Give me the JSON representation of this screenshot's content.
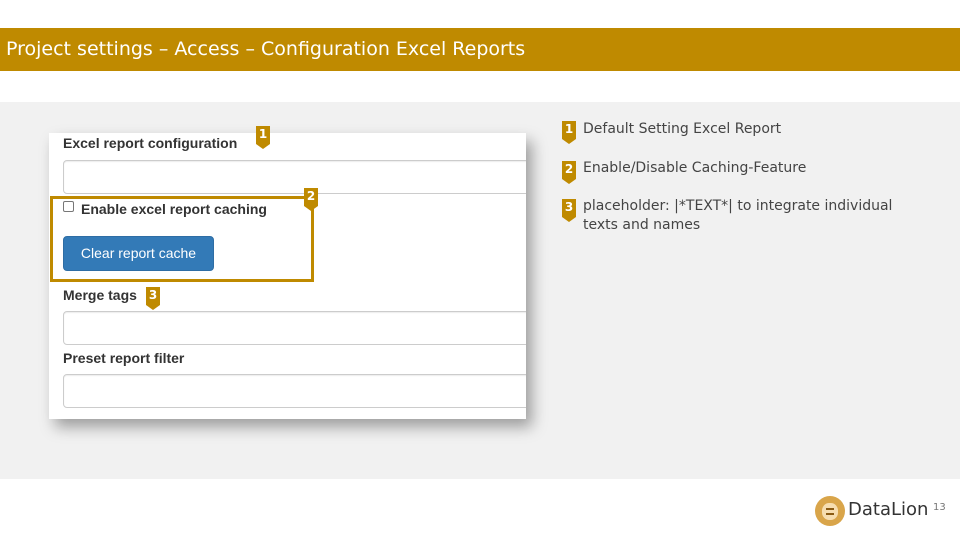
{
  "header": {
    "title": "Project settings – Access – Configuration Excel Reports"
  },
  "form": {
    "excel_config_label": "Excel report configuration",
    "excel_config_value": "",
    "caching_checkbox_label": "Enable excel report caching",
    "caching_checked": false,
    "clear_cache_label": "Clear report cache",
    "merge_tags_label": "Merge tags",
    "merge_tags_value": "",
    "preset_filter_label": "Preset report filter",
    "preset_filter_value": ""
  },
  "markers": [
    "1",
    "2",
    "3"
  ],
  "legend": [
    {
      "number": "1",
      "text": "Default Setting Excel Report"
    },
    {
      "number": "2",
      "text": "Enable/Disable Caching-Feature"
    },
    {
      "number": "3",
      "text": "placeholder: |*TEXT*| to integrate individual texts and names"
    }
  ],
  "footer": {
    "brand": "DataLion",
    "page_number": "13"
  },
  "colors": {
    "accent": "#bf8a00",
    "button": "#337ab7",
    "panel": "#f1f1f1"
  }
}
